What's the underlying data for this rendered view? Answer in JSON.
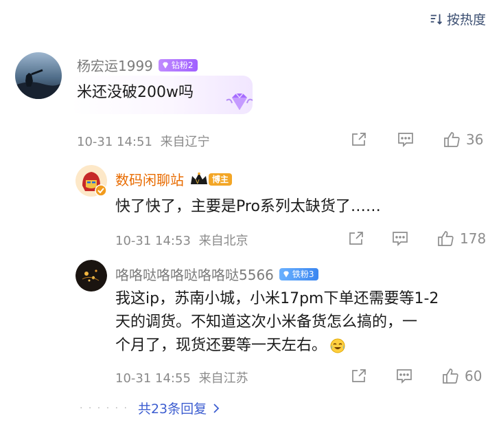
{
  "sort_label": "按热度",
  "comments": [
    {
      "username": "杨宏运1999",
      "badge": "钻粉2",
      "text": "米还没破200w吗",
      "time": "10-31 14:51",
      "location": "来自辽宁",
      "likes": "36"
    },
    {
      "username": "数码闲聊站",
      "badge": "博主",
      "text": "快了快了，主要是Pro系列太缺货了……",
      "time": "10-31 14:53",
      "location": "来自北京",
      "likes": "178"
    },
    {
      "username": "咯咯哒咯咯哒咯咯哒5566",
      "badge": "铁粉3",
      "text_line1": "我这ip，苏南小城，小米17pm下单还需要等1-2",
      "text_line2": "天的调货。不知道这次小米备货怎么搞的，一",
      "text_line3": "个月了，现货还要等一天左右。",
      "time": "10-31 14:55",
      "location": "来自江苏",
      "likes": "60"
    }
  ],
  "more_replies": "共23条回复",
  "colors": {
    "link": "#3c5dd0",
    "blogger_name": "#e86b00",
    "meta": "#8a8a8a"
  }
}
